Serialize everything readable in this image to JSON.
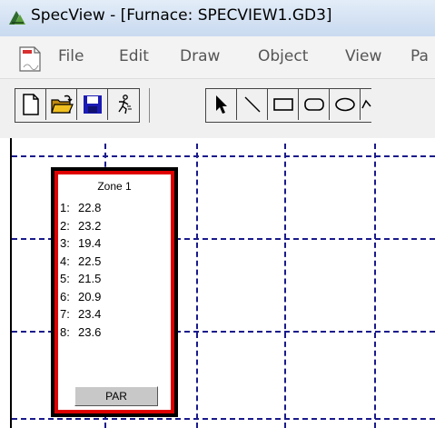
{
  "window": {
    "title": "SpecView - [Furnace: SPECVIEW1.GD3]",
    "app_icon": "specview-logo-icon"
  },
  "menu": {
    "doc_icon": "document-icon",
    "items": [
      "File",
      "Edit",
      "Draw",
      "Object",
      "View",
      "Pa"
    ]
  },
  "toolbar": {
    "file_tools": [
      "new-file-icon",
      "open-folder-icon",
      "save-disk-icon",
      "run-icon"
    ],
    "draw_tools": [
      "select-arrow-icon",
      "line-icon",
      "rectangle-icon",
      "rounded-rectangle-icon",
      "ellipse-icon",
      "polygon-icon"
    ],
    "colors": {
      "save": "#1a1ab4",
      "open_folder": "#f0c020"
    }
  },
  "canvas": {
    "grid_color": "#1a1a8c"
  },
  "zone": {
    "title": "Zone 1",
    "rows": [
      {
        "num": "1:",
        "value": "22.8"
      },
      {
        "num": "2:",
        "value": "23.2"
      },
      {
        "num": "3:",
        "value": "19.4"
      },
      {
        "num": "4:",
        "value": "22.5"
      },
      {
        "num": "5:",
        "value": "21.5"
      },
      {
        "num": "6:",
        "value": "20.9"
      },
      {
        "num": "7:",
        "value": "23.4"
      },
      {
        "num": "8:",
        "value": "23.6"
      }
    ],
    "button_label": "PAR",
    "border_color": "#e00000"
  }
}
